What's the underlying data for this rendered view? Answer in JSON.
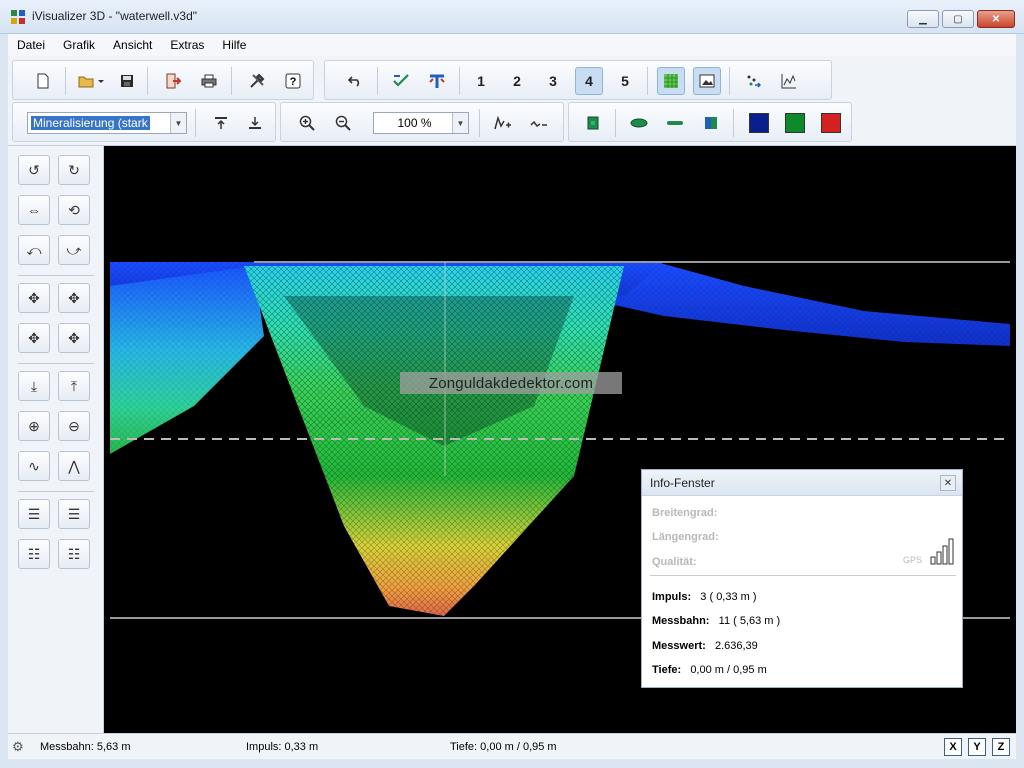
{
  "window": {
    "title": "iVisualizer 3D - \"waterwell.v3d\""
  },
  "menu": [
    "Datei",
    "Grafik",
    "Ansicht",
    "Extras",
    "Hilfe"
  ],
  "toolbar": {
    "view_numbers": [
      "1",
      "2",
      "3",
      "4",
      "5"
    ],
    "active_view": "4",
    "mineral_select": "Mineralisierung (stark",
    "zoom_select": "100 %",
    "colors": {
      "blue": "#0a1e8c",
      "green": "#0f8a2a",
      "red": "#d42020"
    }
  },
  "canvas": {
    "watermark": "Zonguldakdedektor.com"
  },
  "info": {
    "title": "Info-Fenster",
    "breitengrad": "Breitengrad:",
    "laengengrad": "Längengrad:",
    "qualitaet": "Qualität:",
    "gps": "GPS",
    "impuls_label": "Impuls:",
    "impuls_value": "3 ( 0,33 m )",
    "messbahn_label": "Messbahn:",
    "messbahn_value": "11 ( 5,63 m )",
    "messwert_label": "Messwert:",
    "messwert_value": "2.636,39",
    "tiefe_label": "Tiefe:",
    "tiefe_value": "0,00 m / 0,95 m"
  },
  "status": {
    "messbahn": "Messbahn: 5,63 m",
    "impuls": "Impuls: 0,33 m",
    "tiefe": "Tiefe: 0,00 m / 0,95 m",
    "axes": [
      "X",
      "Y",
      "Z"
    ]
  }
}
